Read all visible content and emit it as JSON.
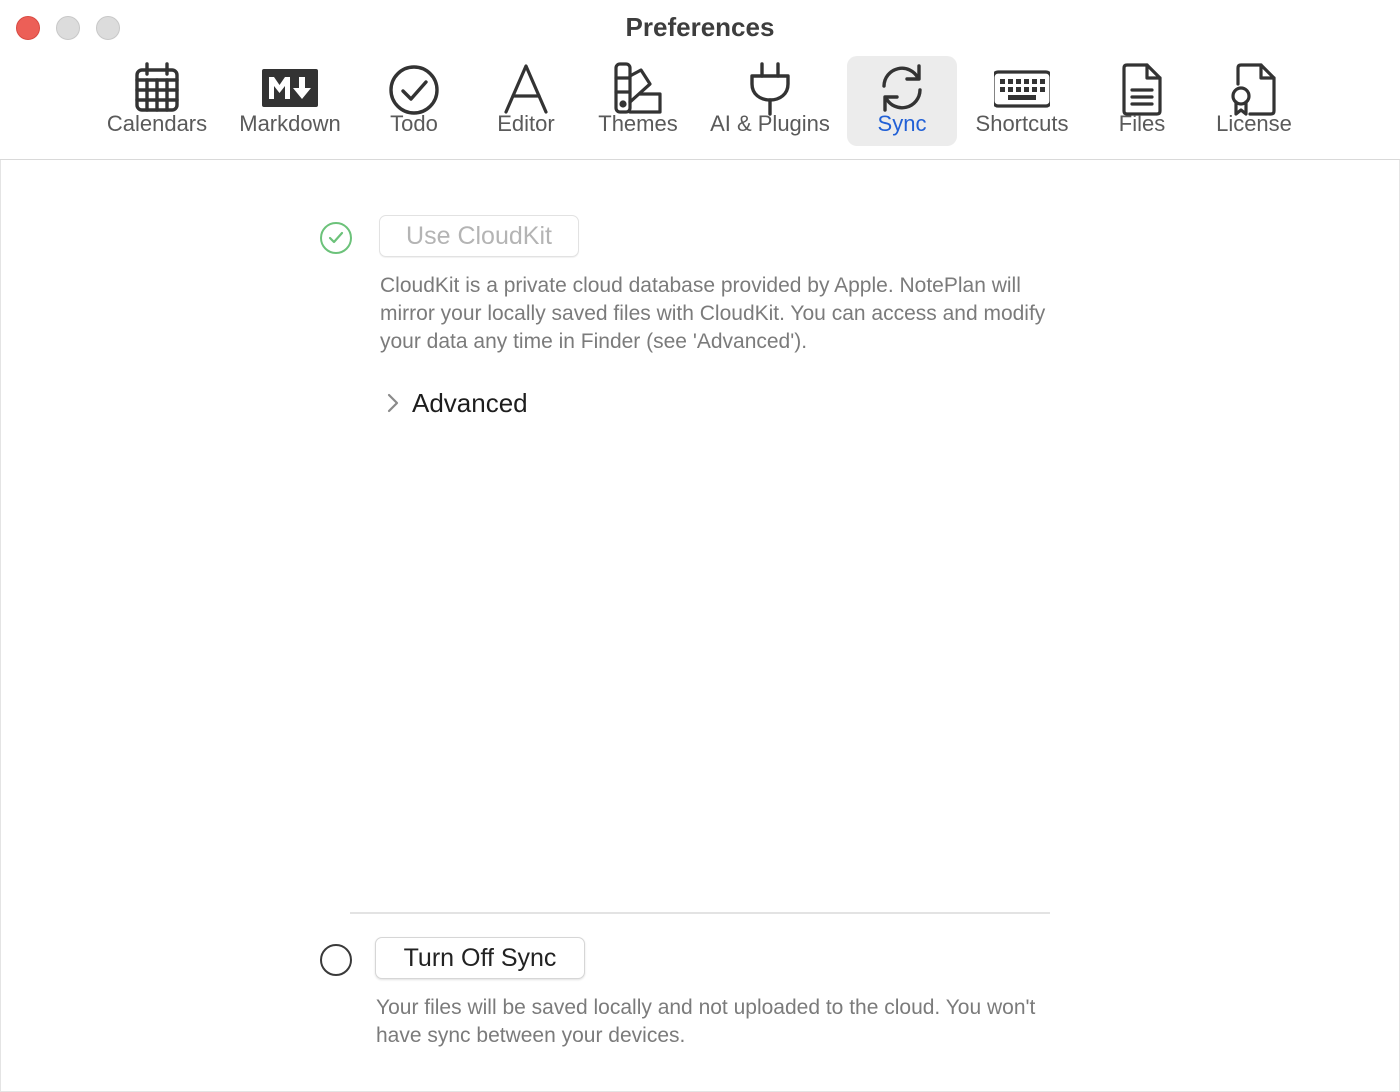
{
  "window": {
    "title": "Preferences"
  },
  "toolbar": {
    "items": [
      {
        "label": "Calendars",
        "icon": "calendar-icon",
        "selected": false
      },
      {
        "label": "Markdown",
        "icon": "markdown-icon",
        "selected": false
      },
      {
        "label": "Todo",
        "icon": "todo-check-icon",
        "selected": false
      },
      {
        "label": "Editor",
        "icon": "font-a-icon",
        "selected": false
      },
      {
        "label": "Themes",
        "icon": "palette-swatch-icon",
        "selected": false
      },
      {
        "label": "AI & Plugins",
        "icon": "plug-icon",
        "selected": false
      },
      {
        "label": "Sync",
        "icon": "sync-arrows-icon",
        "selected": true
      },
      {
        "label": "Shortcuts",
        "icon": "keyboard-icon",
        "selected": false
      },
      {
        "label": "Files",
        "icon": "document-icon",
        "selected": false
      },
      {
        "label": "License",
        "icon": "license-certificate-icon",
        "selected": false
      }
    ],
    "accent_color": "#2160d6"
  },
  "sync": {
    "cloudkit": {
      "selected": true,
      "button_label": "Use CloudKit",
      "description": "CloudKit is a private cloud database provided by Apple. NotePlan will mirror your locally saved files with CloudKit. You can access and modify your data any time in Finder (see 'Advanced').",
      "advanced_label": "Advanced",
      "check_color": "#6cc27a"
    },
    "off": {
      "selected": false,
      "button_label": "Turn Off Sync",
      "description": "Your files will be saved locally and not uploaded to the cloud. You won't have sync between your devices."
    }
  }
}
